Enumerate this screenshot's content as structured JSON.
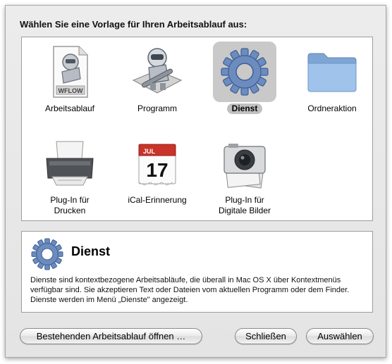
{
  "dialog": {
    "prompt": "Wählen Sie eine Vorlage für Ihren Arbeitsablauf aus:"
  },
  "templates": [
    {
      "label": "Arbeitsablauf",
      "icon": "automator-workflow-document-icon",
      "selected": false,
      "badge": "WFLOW"
    },
    {
      "label": "Programm",
      "icon": "automator-robot-icon",
      "selected": false
    },
    {
      "label": "Dienst",
      "icon": "gear-icon",
      "selected": true
    },
    {
      "label": "Ordneraktion",
      "icon": "folder-icon",
      "selected": false
    },
    {
      "label_line1": "Plug-In für",
      "label_line2": "Drucken",
      "icon": "printer-icon",
      "selected": false
    },
    {
      "label": "iCal-Erinnerung",
      "icon": "calendar-icon",
      "selected": false,
      "month": "JUL",
      "day": "17"
    },
    {
      "label_line1": "Plug-In für",
      "label_line2": "Digitale Bilder",
      "icon": "camera-icon",
      "selected": false
    }
  ],
  "description": {
    "title": "Dienst",
    "icon": "gear-icon",
    "text": "Dienste sind kontextbezogene Arbeitsabläufe, die überall in Mac OS X über Kontextmenüs verfügbar sind. Sie akzeptieren Text oder Dateien vom aktuellen Programm oder dem Finder. Dienste werden im Menü „Dienste\" angezeigt."
  },
  "buttons": {
    "open_existing": "Bestehenden Arbeitsablauf öffnen …",
    "close": "Schließen",
    "choose": "Auswählen"
  },
  "colors": {
    "selection": "#c9c9c9",
    "gear": "#6c8cc0",
    "folder": "#8fb6e0"
  }
}
